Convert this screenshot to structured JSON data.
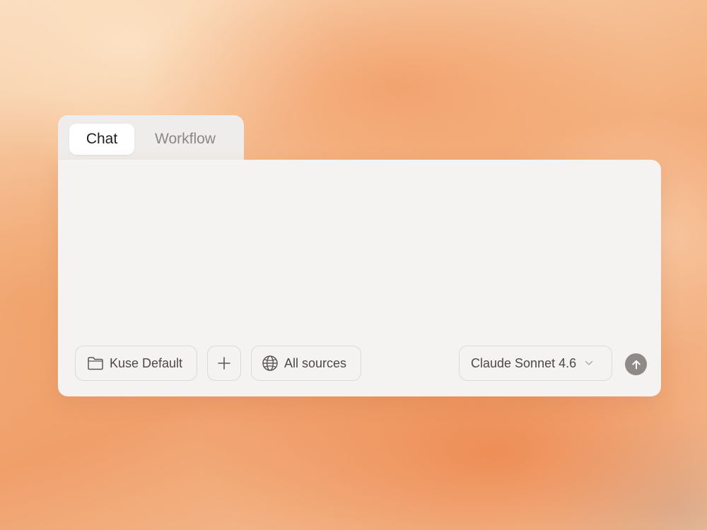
{
  "tabs": {
    "chat_label": "Chat",
    "workflow_label": "Workflow"
  },
  "toolbar": {
    "project_label": "Kuse Default",
    "add_label": "+",
    "sources_label": "All sources",
    "model_label": "Claude Sonnet 4.6"
  },
  "icons": {
    "project": "folder-icon",
    "sources": "globe-icon",
    "model_dropdown": "chevron-down-icon",
    "send": "arrow-up-icon"
  }
}
